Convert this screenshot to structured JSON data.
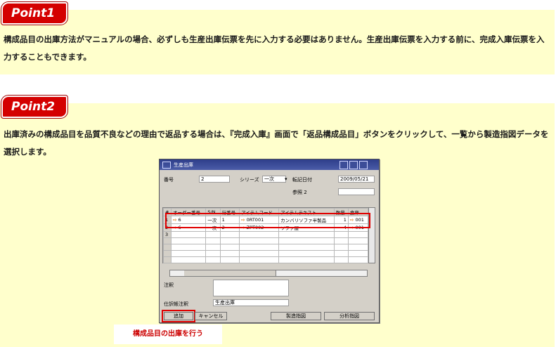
{
  "point1": {
    "badge": "Point1",
    "text": "構成品目の出庫方法がマニュアルの場合、必ずしも生産出庫伝票を先に入力する必要はありません。生産出庫伝票を入力する前に、完成入庫伝票を入力することもできます。"
  },
  "point2": {
    "badge": "Point2",
    "text": "出庫済みの構成品目を品質不良などの理由で返品する場合は、『完成入庫』画面で「返品構成品目」ボタンをクリックして、一覧から製造指図データを選択します。"
  },
  "window": {
    "title": "生産出庫",
    "number_label": "番号",
    "number_value": "2",
    "series_label": "シリーズ",
    "series_value": "一次",
    "date_label": "転記日付",
    "date_value": "2009/05/21",
    "ref_label": "参照 2",
    "columns": [
      "#",
      "オーダー番号",
      "S/N",
      "行番号",
      "アイテムコード",
      "アイテムテキスト",
      "数量",
      "倉庫"
    ],
    "rows": [
      [
        "1",
        "6",
        "一次",
        "1",
        "0RT001",
        "カンバリソファ半製品",
        "1",
        "001"
      ],
      [
        "2",
        "6",
        "一次",
        "2",
        "ZPT002",
        "ソファ屋",
        "4",
        "001"
      ],
      [
        "3",
        "",
        "",
        "",
        "",
        "",
        "",
        ""
      ],
      [
        "",
        "",
        "",
        "",
        "",
        "",
        "",
        ""
      ],
      [
        "",
        "",
        "",
        "",
        "",
        "",
        "",
        ""
      ],
      [
        "",
        "",
        "",
        "",
        "",
        "",
        "",
        ""
      ]
    ],
    "remarks_label": "注釈",
    "journal_label": "仕訳帳注釈",
    "journal_value": "生産出庫",
    "add_button": "追加",
    "cancel_button": "キャンセル",
    "copy_from_button": "製造指図",
    "copy_to_button": "分析指図"
  },
  "callout": "構成品目の出庫を行う"
}
